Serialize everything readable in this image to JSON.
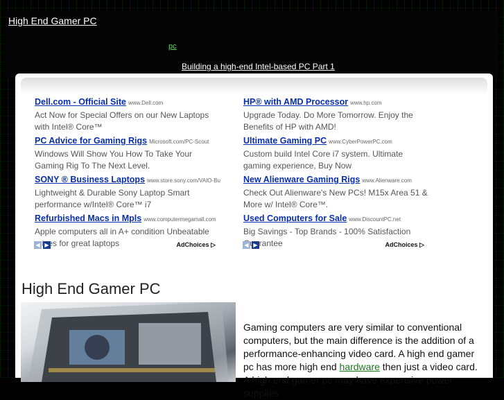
{
  "site": {
    "title": "High End Gamer PC",
    "tag_link": "pc",
    "post_link": "Building a high-end Intel-based PC Part 1"
  },
  "ads": {
    "left": [
      {
        "title": "Dell.com - Official Site",
        "url": "www.Dell.com",
        "desc": "Act Now for Special Offers on our New Laptops with Intel® Core™"
      },
      {
        "title": "PC Advice for Gaming Rigs",
        "url": "Microsoft.com/PC-Scout",
        "desc": "Windows Will Show You How To Take Your Gaming Rig To The Next Level."
      },
      {
        "title": "SONY ® Business Laptops",
        "url": "www.store.sony.com/VAIO-Bu",
        "desc": "Lightweight & Durable Sony Laptop Smart performance w/Intel® Core™ i7"
      },
      {
        "title": "Refurbished Macs in Mpls",
        "url": "www.computermegamall.com",
        "desc": "Apple computers all in A+ condition Unbeatable prices for great laptops"
      }
    ],
    "right": [
      {
        "title": "HP® with AMD Processor",
        "url": "www.hp.com",
        "desc": "Upgrade Today. Do More Tomorrow. Enjoy the Benefits of HP with AMD!"
      },
      {
        "title": "Ultimate Gaming PC",
        "url": "www.CyberPowerPC.com",
        "desc": "Custom build Intel Core i7 system. Ultimate gaming experience, Buy Now"
      },
      {
        "title": "New Alienware Gaming Rigs",
        "url": "www.Alienware.com",
        "desc": "Check Out Alienware's New PCs! M15x Area 51 & More w/ Intel® Core™."
      },
      {
        "title": "Used Computers for Sale",
        "url": "www.DiscountPC.net",
        "desc": "Big Savings - Top Brands - 100% Satisfaction Guarantee"
      }
    ],
    "adchoices_label": "AdChoices",
    "prev_symbol": "◀",
    "next_symbol": "▶"
  },
  "post": {
    "title": "High End Gamer PC",
    "text_before": "Gaming computers are very similar to conventional computers, but the main difference is the addition of a performance-enhancing video card.  A high end gamer pc has more high end ",
    "link_word": "hardware",
    "text_after": " then just a video card.  A high end gamer pc may have expensive power supplies"
  },
  "colors": {
    "background": "#000000",
    "ad_title": "#0a2fa8",
    "link_green": "#5fd35f"
  }
}
